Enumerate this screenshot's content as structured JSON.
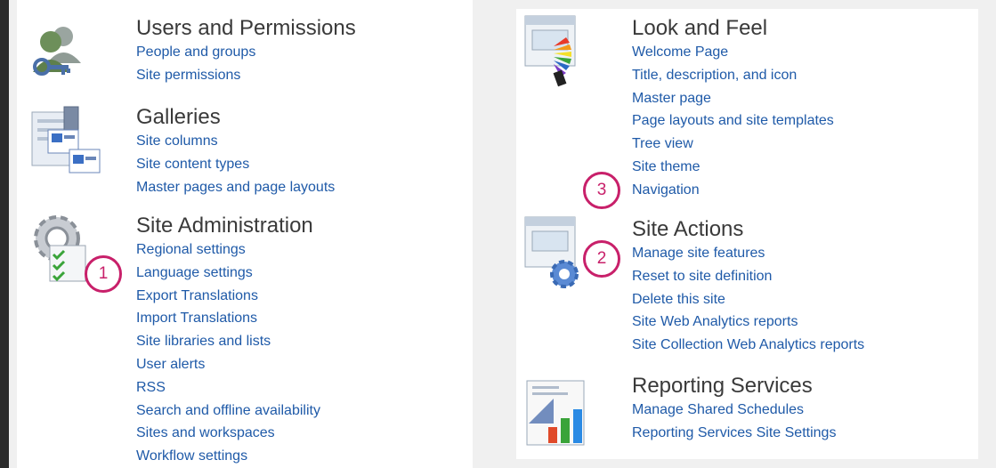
{
  "sections": {
    "users": {
      "title": "Users and Permissions",
      "links": [
        "People and groups",
        "Site permissions"
      ]
    },
    "galleries": {
      "title": "Galleries",
      "links": [
        "Site columns",
        "Site content types",
        "Master pages and page layouts"
      ]
    },
    "site_admin": {
      "title": "Site Administration",
      "links": [
        "Regional settings",
        "Language settings",
        "Export Translations",
        "Import Translations",
        "Site libraries and lists",
        "User alerts",
        "RSS",
        "Search and offline availability",
        "Sites and workspaces",
        "Workflow settings"
      ]
    },
    "look_feel": {
      "title": "Look and Feel",
      "links": [
        "Welcome Page",
        "Title, description, and icon",
        "Master page",
        "Page layouts and site templates",
        "Tree view",
        "Site theme",
        "Navigation"
      ]
    },
    "site_actions": {
      "title": "Site Actions",
      "links": [
        "Manage site features",
        "Reset to site definition",
        "Delete this site",
        "Site Web Analytics reports",
        "Site Collection Web Analytics reports"
      ]
    },
    "reporting": {
      "title": "Reporting Services",
      "links": [
        "Manage Shared Schedules",
        "Reporting Services Site Settings"
      ]
    }
  },
  "markers": [
    "1",
    "2",
    "3"
  ],
  "colors": {
    "link": "#1f5aa8",
    "title": "#3a3a3a",
    "highlight": "#f8f86a",
    "marker": "#c8206a",
    "background": "#f0f0f0"
  },
  "icons": {
    "users": "users-permissions-icon",
    "galleries": "galleries-icon",
    "site_admin": "site-administration-icon",
    "look_feel": "look-and-feel-icon",
    "site_actions": "site-actions-icon",
    "reporting": "reporting-services-icon"
  }
}
